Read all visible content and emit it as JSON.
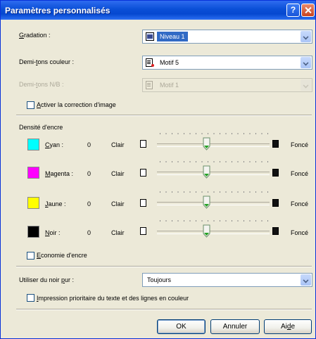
{
  "window": {
    "title": "Paramètres personnalisés",
    "help_glyph": "?"
  },
  "gradation": {
    "label_u": "G",
    "label_rest": "radation :",
    "value": "Niveau 1",
    "icon": "gradation-icon"
  },
  "halftone_color": {
    "label_pre": "Demi-",
    "label_u": "t",
    "label_rest": "ons couleur :",
    "value": "Motif 5",
    "icon": "halftone-pattern-icon"
  },
  "halftone_bw": {
    "label_pre": "Demi-",
    "label_u": "t",
    "label_rest": "ons N/B :",
    "value": "Motif 1",
    "icon": "halftone-pattern-icon",
    "disabled": true
  },
  "image_correction": {
    "label_pre": "",
    "label_u": "A",
    "label_rest": "ctiver la correction d'image",
    "checked": false
  },
  "ink_density": {
    "title": "Densité d'encre",
    "light_label": "Clair",
    "dark_label": "Foncé",
    "inks": [
      {
        "name_u": "C",
        "name_rest": "yan :",
        "value": "0",
        "color": "#00ffff"
      },
      {
        "name_u": "M",
        "name_rest": "agenta :",
        "value": "0",
        "color": "#ff00ff"
      },
      {
        "name_u": "J",
        "name_rest": "aune :",
        "value": "0",
        "color": "#ffff00"
      },
      {
        "name_u": "N",
        "name_rest": "oir :",
        "value": "0",
        "color": "#000000"
      }
    ]
  },
  "ink_saving": {
    "label_u": "E",
    "label_rest": "conomie d'encre",
    "checked": false
  },
  "pure_black": {
    "label_pre": "Utiliser du noir ",
    "label_u": "p",
    "label_rest": "ur :",
    "value": "Toujours"
  },
  "priority_print": {
    "label_u": "I",
    "label_rest": "mpression prioritaire du texte et des lignes en couleur",
    "checked": false
  },
  "buttons": {
    "ok": "OK",
    "cancel": "Annuler",
    "help_pre": "Ai",
    "help_u": "d",
    "help_rest": "e"
  }
}
